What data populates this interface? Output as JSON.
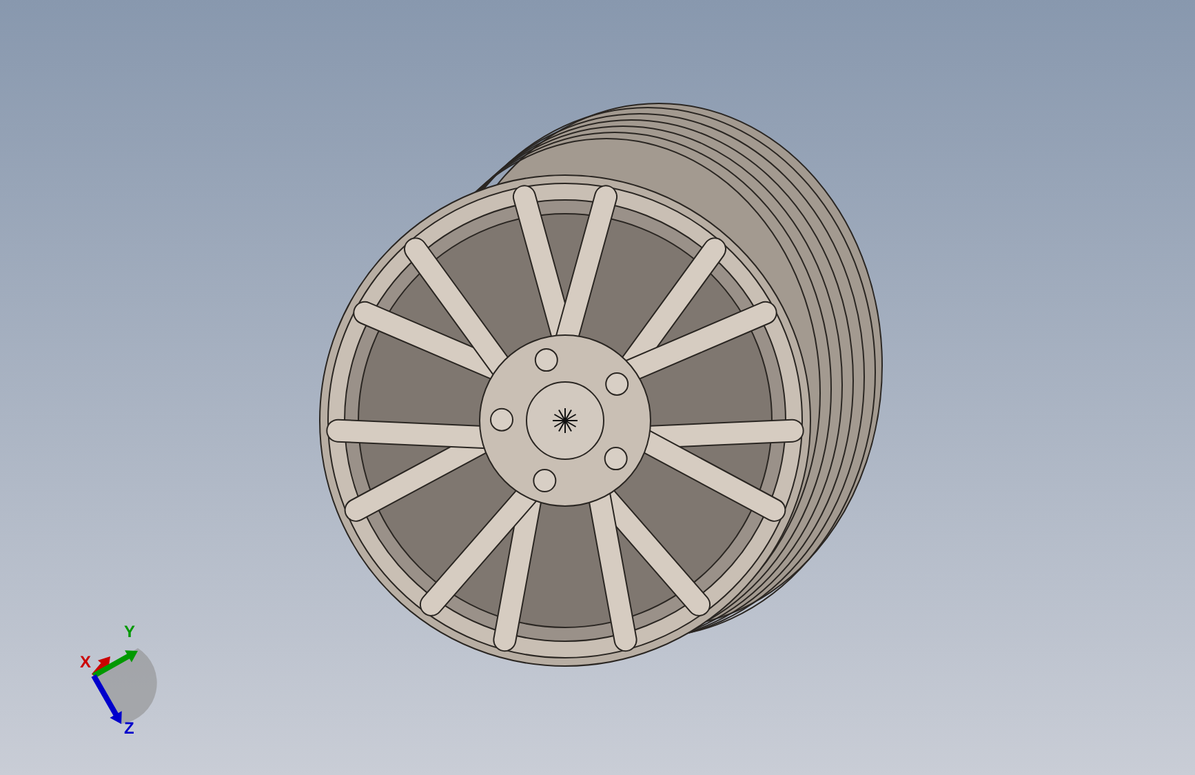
{
  "viewport": {
    "triad": {
      "axes": [
        {
          "kind": "x",
          "label": "X",
          "color": "#cc0000"
        },
        {
          "kind": "y",
          "label": "Y",
          "color": "#009900"
        },
        {
          "kind": "z",
          "label": "Z",
          "color": "#0000cc"
        }
      ]
    }
  }
}
